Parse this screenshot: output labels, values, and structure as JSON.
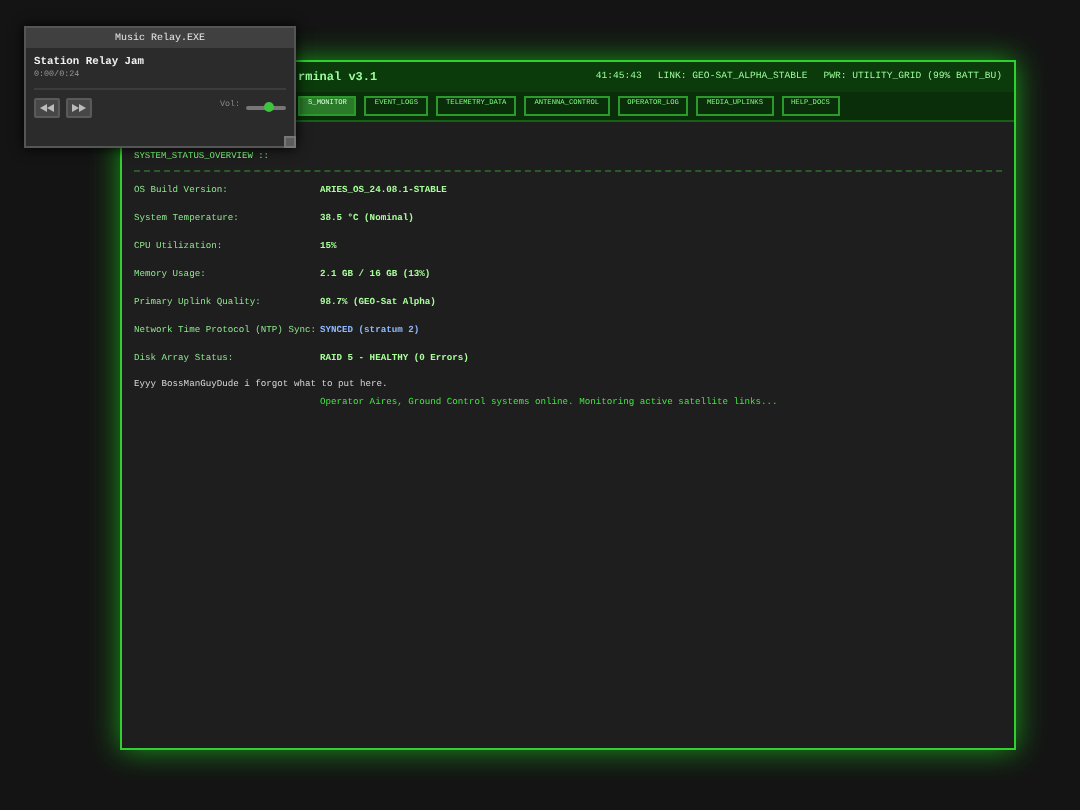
{
  "terminal": {
    "title": "rminal v3.1",
    "status": [
      {
        "text": "41:45:43"
      },
      {
        "text": "LINK: GEO-SAT_ALPHA_STABLE"
      },
      {
        "text": "PWR: UTILITY_GRID (99% BATT_BU)"
      }
    ],
    "tabs": [
      {
        "label": "S_MONITOR",
        "selected": true
      },
      {
        "label": "EVENT_LOGS",
        "selected": false
      },
      {
        "label": "TELEMETRY_DATA",
        "selected": false
      },
      {
        "label": "ANTENNA_CONTROL",
        "selected": false
      },
      {
        "label": "OPERATOR_LOG",
        "selected": false
      },
      {
        "label": "MEDIA_UPLINKS",
        "selected": false
      },
      {
        "label": "HELP_DOCS",
        "selected": false
      }
    ],
    "section_title": "SYSTEM_STATUS_OVERVIEW ::",
    "rows": [
      {
        "label": "OS Build Version:",
        "value": "ARIES_OS_24.08.1-STABLE",
        "color": "#a8ff9a"
      },
      {
        "label": "System Temperature:",
        "value": "38.5 °C (Nominal)",
        "color": "#a8ff9a"
      },
      {
        "label": "CPU Utilization:",
        "value": "15%",
        "color": "#a8ff9a"
      },
      {
        "label": "Memory Usage:",
        "value": "2.1 GB / 16 GB (13%)",
        "color": "#a8ff9a"
      },
      {
        "label": "Primary Uplink Quality:",
        "value": "98.7% (GEO-Sat Alpha)",
        "color": "#a8ff9a"
      },
      {
        "label": "Network Time Protocol (NTP) Sync:",
        "value": "SYNCED (stratum 2)",
        "color": "#8fb8ff"
      },
      {
        "label": "Disk Array Status:",
        "value": "RAID 5 - HEALTHY (0 Errors)",
        "color": "#a8ff9a"
      }
    ],
    "note": "Eyyy BossManGuyDude i forgot what to put here.",
    "log": "Operator Aires, Ground Control systems online. Monitoring active satellite links..."
  },
  "player": {
    "title": "Music Relay.EXE",
    "track": "Station Relay Jam",
    "time": "0:00/0:24",
    "volume_label": "Vol:",
    "volume": {
      "level": 0.55
    }
  }
}
